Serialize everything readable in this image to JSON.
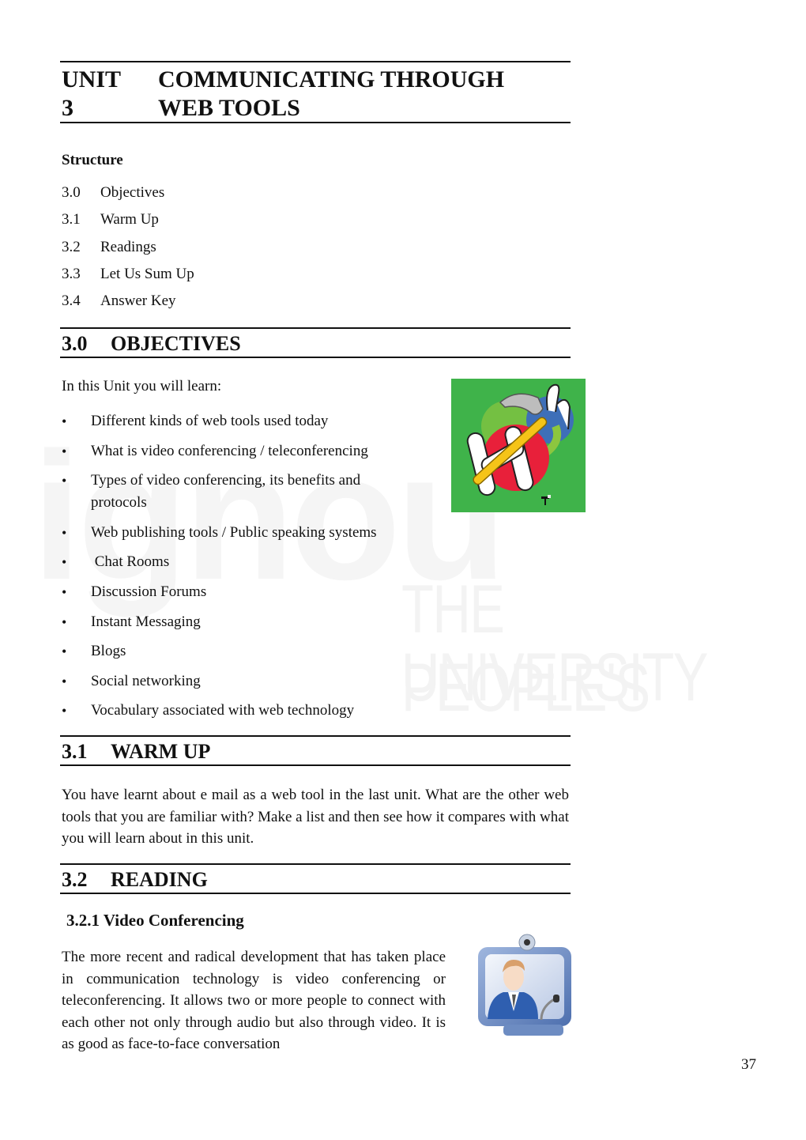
{
  "watermark": {
    "brand": "ignou",
    "line1": "THE PEOPLE'S",
    "line2": "UNIVERSITY"
  },
  "unit": {
    "number": "UNIT 3",
    "title_line1": "COMMUNICATING THROUGH",
    "title_line2": "WEB TOOLS"
  },
  "structure": {
    "heading": "Structure",
    "items": [
      {
        "num": "3.0",
        "label": "Objectives"
      },
      {
        "num": "3.1",
        "label": "Warm Up"
      },
      {
        "num": "3.2",
        "label": "Readings"
      },
      {
        "num": "3.3",
        "label": "Let Us Sum Up"
      },
      {
        "num": "3.4",
        "label": "Answer Key"
      }
    ]
  },
  "objectives": {
    "num": "3.0",
    "title": "OBJECTIVES",
    "intro": "In this Unit you will learn:",
    "bullets": [
      "Different kinds of web tools used today",
      "What is video conferencing / teleconferencing",
      "Types of video conferencing, its benefits and protocols",
      "Web publishing tools / Public speaking systems",
      " Chat Rooms",
      "Discussion Forums",
      "Instant Messaging",
      "Blogs",
      "Social networking",
      "Vocabulary associated with web technology"
    ],
    "image": "web-tools-hammer-logo"
  },
  "warmup": {
    "num": "3.1",
    "title": "WARM UP",
    "text": "You have learnt about e mail as a web tool in the last unit. What are the other web tools that you are familiar with? Make a list and then see how it compares with what you will learn about in this unit."
  },
  "reading": {
    "num": "3.2",
    "title": "READING",
    "subsection": "3.2.1 Video Conferencing",
    "text": "The more recent and radical development that has taken place in communication technology is video conferencing or teleconferencing. It allows two or more people to connect with each other not only through audio but also through video. It is as good as face-to-face conversation",
    "image": "video-conference-monitor"
  },
  "page_number": "37"
}
